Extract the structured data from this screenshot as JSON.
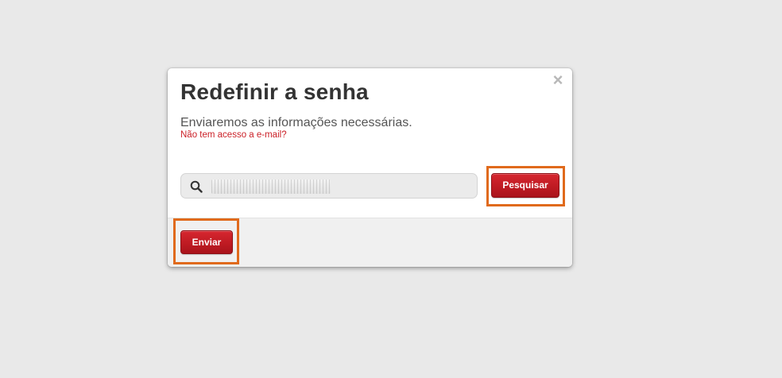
{
  "dialog": {
    "title": "Redefinir a senha",
    "subtitle": "Enviaremos as informações necessárias.",
    "help_link": "Não tem acesso a e-mail?",
    "close_glyph": "×",
    "close_icon": "close-icon"
  },
  "search": {
    "icon": "search-icon",
    "value": "",
    "button_label": "Pesquisar"
  },
  "footer": {
    "send_label": "Enviar"
  },
  "colors": {
    "accent_red": "#cb2027",
    "highlight_orange": "#e06a1c",
    "background": "#e9e9e9"
  }
}
